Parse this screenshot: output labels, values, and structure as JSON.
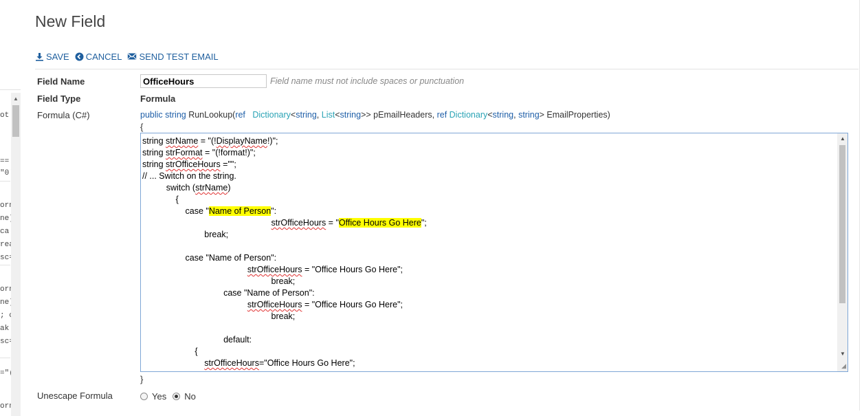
{
  "page": {
    "title": "New Field"
  },
  "toolbar": {
    "save_label": "SAVE",
    "cancel_label": "CANCEL",
    "send_test_label": "SEND TEST EMAIL"
  },
  "left_fragments": [
    "ot",
    "==",
    "\"0'",
    "orn",
    "ne)",
    "ca",
    "rea",
    "sc=",
    "orn",
    "ne)",
    "; ca",
    "ak",
    "sc=",
    "=\"(",
    "orn"
  ],
  "form": {
    "field_name_label": "Field Name",
    "field_name_value": "OfficeHours",
    "field_name_hint": "Field name must not include spaces or punctuation",
    "field_type_label": "Field Type",
    "field_type_value": "Formula",
    "formula_label": "Formula (C#)",
    "signature": {
      "public": "public",
      "string1": "string",
      "method": " RunLookup(",
      "ref1": "ref",
      "dict1": "Dictionary",
      "lt1": "<",
      "string2": "string",
      "comma1": ", ",
      "list": "List",
      "lt2": "<",
      "string3": "string",
      "gt1": ">> pEmailHeaders, ",
      "ref2": "ref",
      "dict2": "Dictionary",
      "lt3": "<",
      "string4": "string",
      "comma2": ", ",
      "string5": "string",
      "gt2": "> EmailProperties)"
    },
    "open_brace": "{",
    "close_brace": "}",
    "code": {
      "l1a": "string ",
      "l1b": "strName",
      "l1c": " = \"(!",
      "l1d": "DisplayName",
      "l1e": "!)\";",
      "l2a": "string ",
      "l2b": "strFormat",
      "l2c": " = \"(!format!)\";",
      "l3a": "string ",
      "l3b": "strOfficeHours",
      "l3c": " =\"\";",
      "l4": "// ... Switch on the string.",
      "l5a": "          switch (",
      "l5b": "strName",
      "l5c": ")",
      "l6": "              {",
      "l7a": "                  case \"",
      "l7b": "Name of Person",
      "l7c": "\":",
      "l8a": "                                                      ",
      "l8b": "strOfficeHours",
      "l8c": " = \"",
      "l8d": "Office Hours Go Here",
      "l8e": "\";",
      "l9": "                          break;",
      "l10": "",
      "l11": "                  case \"Name of Person\":",
      "l12a": "                                            ",
      "l12b": "strOfficeHours",
      "l12c": " = \"Office Hours Go Here\";",
      "l13": "                                                      break;",
      "l14": "                                  case \"Name of Person\":",
      "l15a": "                                            ",
      "l15b": "strOfficeHours",
      "l15c": " = \"Office Hours Go Here\";",
      "l16": "                                                      break;",
      "l17": "",
      "l18": "                                  default:",
      "l19": "                      {",
      "l20a": "                          ",
      "l20b": "strOfficeHours",
      "l20c": "=\"Office Hours Go Here\";"
    },
    "unescape_label": "Unescape Formula",
    "unescape_yes": "Yes",
    "unescape_no": "No",
    "unescape_selected": "No"
  },
  "colors": {
    "link": "#1f5f9e",
    "keyword": "#1f5fa8",
    "type": "#2aa3b5",
    "highlight": "#ffff00",
    "focus_border": "#7ea6d6"
  }
}
